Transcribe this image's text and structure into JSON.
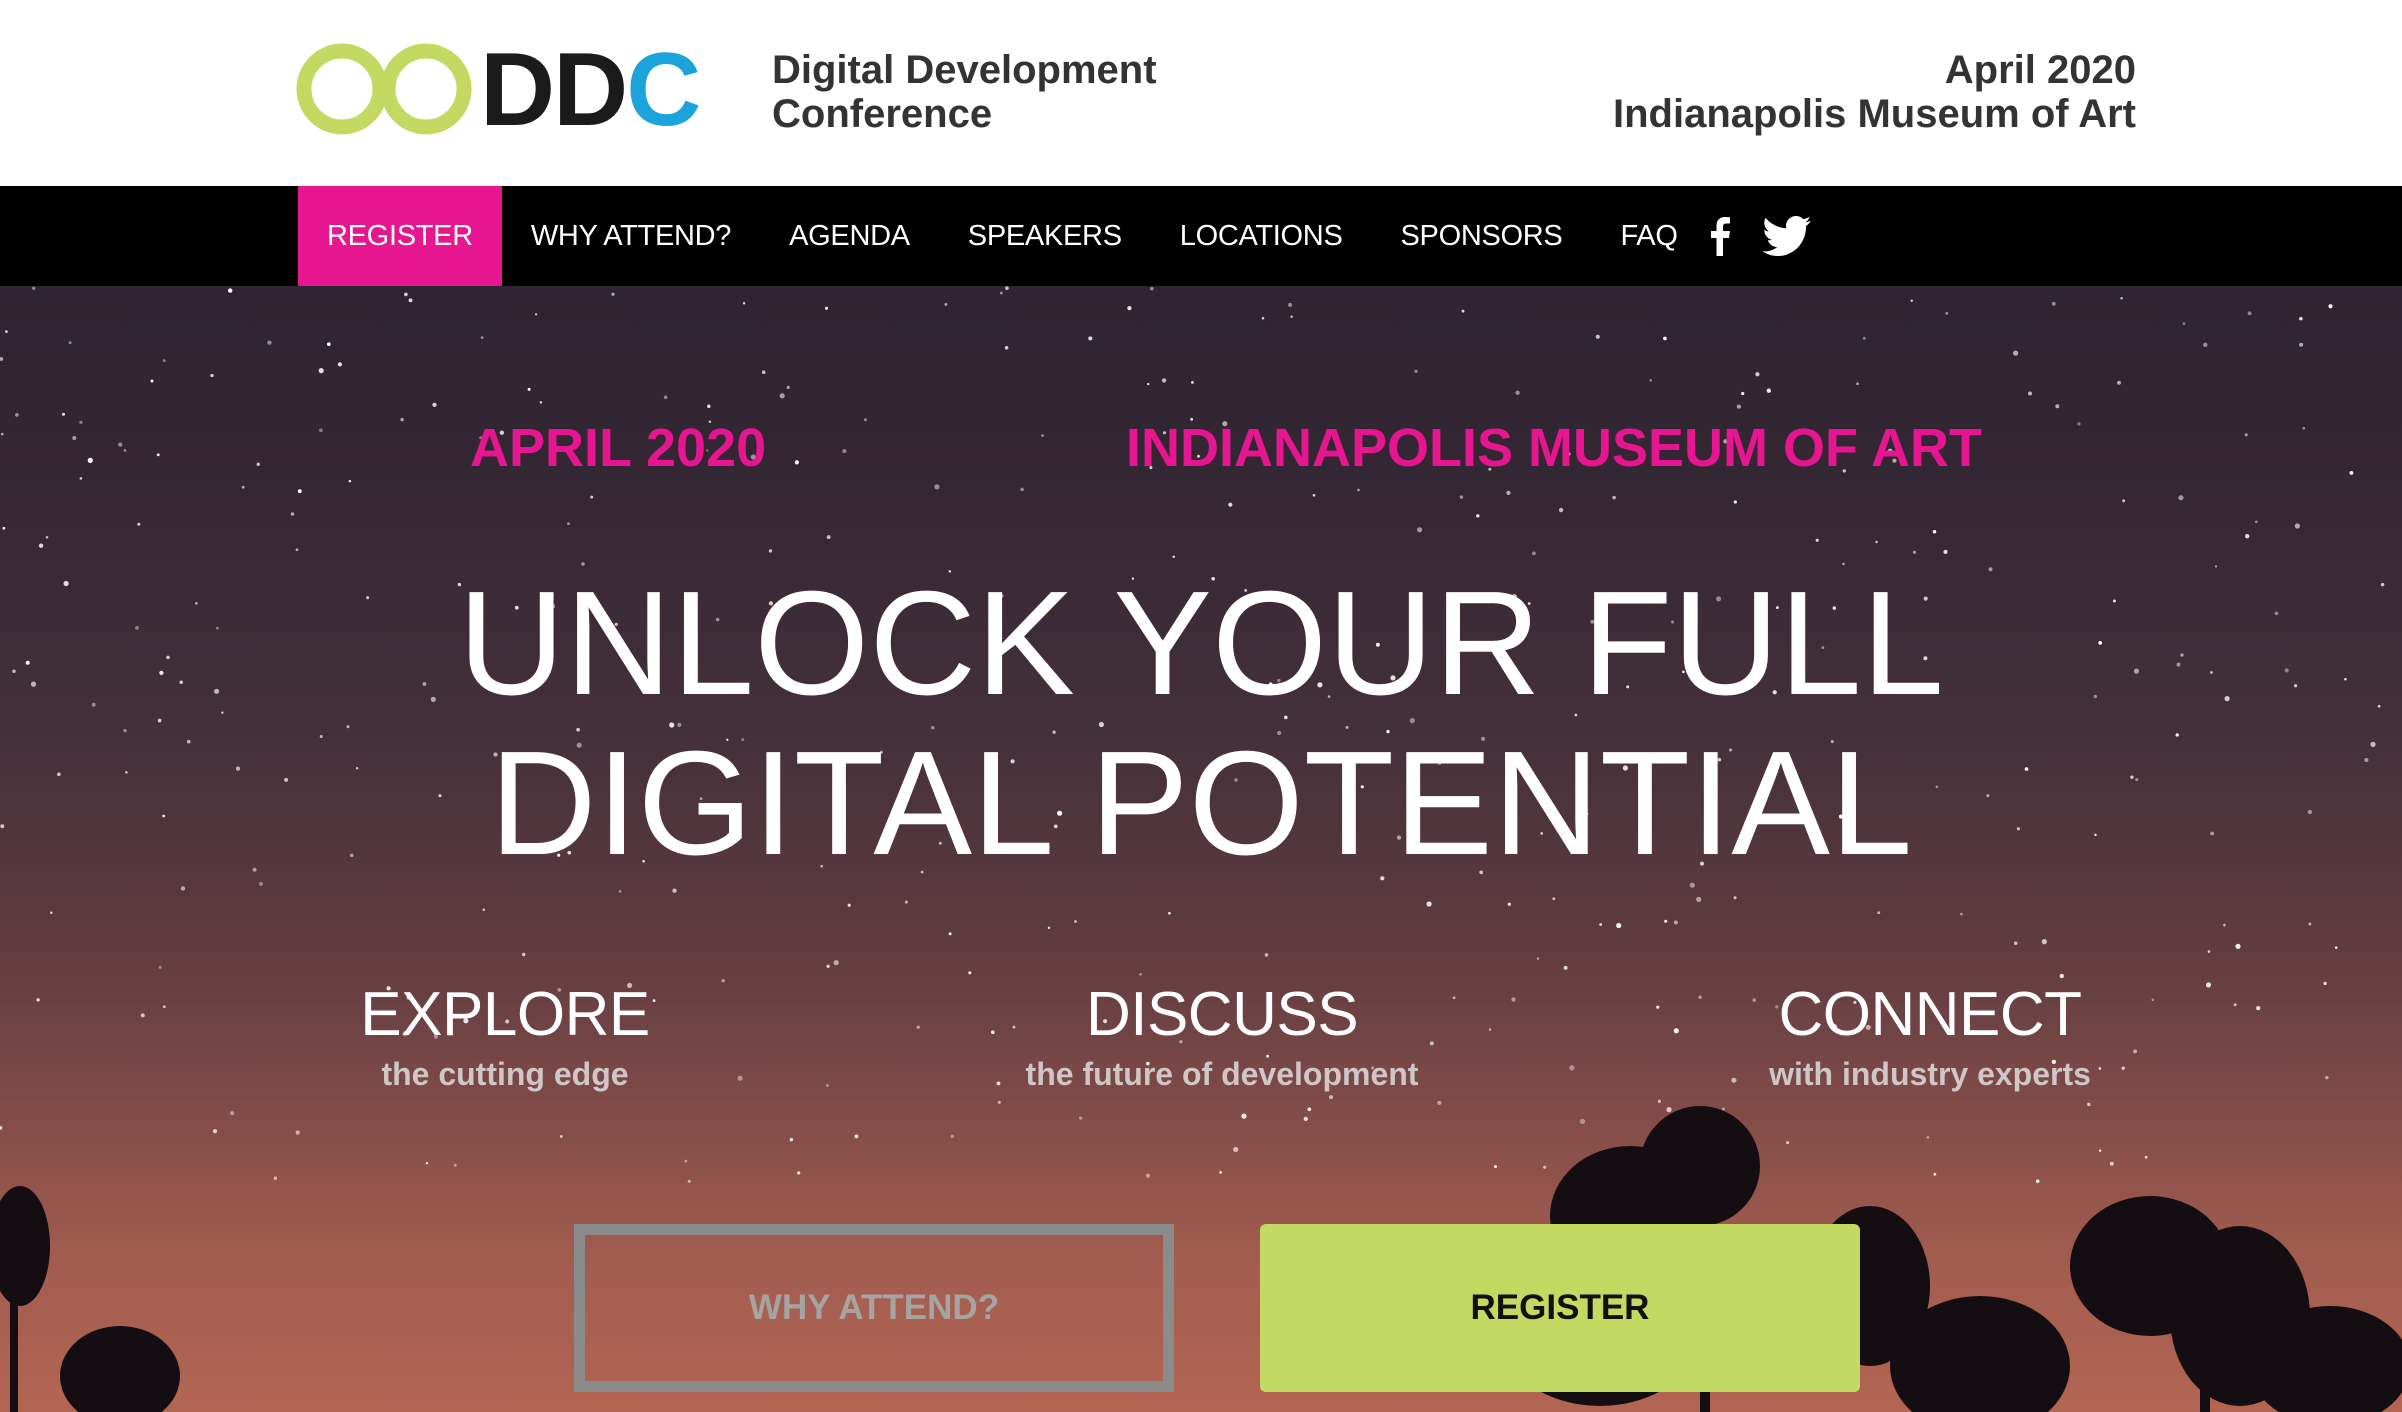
{
  "header": {
    "logo_text_d": "DD",
    "logo_text_c": "C",
    "brand_line1": "Digital Development",
    "brand_line2": "Conference",
    "date": "April 2020",
    "venue": "Indianapolis Museum of Art"
  },
  "nav": {
    "items": [
      {
        "label": "REGISTER",
        "active": true
      },
      {
        "label": "WHY ATTEND?"
      },
      {
        "label": "AGENDA"
      },
      {
        "label": "SPEAKERS"
      },
      {
        "label": "LOCATIONS"
      },
      {
        "label": "SPONSORS"
      },
      {
        "label": "FAQ"
      }
    ],
    "social": [
      "facebook-icon",
      "twitter-icon"
    ]
  },
  "hero": {
    "date": "APRIL 2020",
    "venue": "INDIANAPOLIS MUSEUM OF ART",
    "headline_line1": "UNLOCK YOUR FULL",
    "headline_line2": "DIGITAL POTENTIAL",
    "pillars": [
      {
        "title": "EXPLORE",
        "sub": "the cutting edge"
      },
      {
        "title": "DISCUSS",
        "sub": "the future of development"
      },
      {
        "title": "CONNECT",
        "sub": "with industry experts"
      }
    ],
    "buttons": {
      "why": "WHY ATTEND?",
      "register": "REGISTER"
    }
  },
  "colors": {
    "accent_pink": "#e5168f",
    "logo_green": "#c4d962",
    "logo_blue": "#1ba3dc",
    "register_button": "#c4d962"
  }
}
